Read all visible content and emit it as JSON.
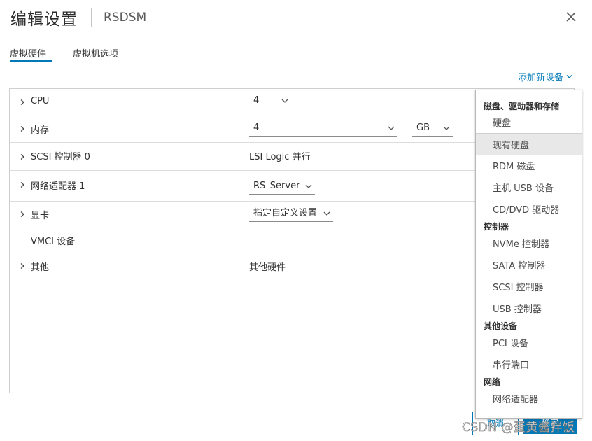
{
  "header": {
    "title": "编辑设置",
    "vm_name": "RSDSM"
  },
  "tabs": [
    {
      "label": "虚拟硬件",
      "active": true
    },
    {
      "label": "虚拟机选项",
      "active": false
    }
  ],
  "add_device_label": "添加新设备",
  "hardware": {
    "rows": [
      {
        "label": "CPU",
        "value": "4",
        "type": "select"
      },
      {
        "label": "内存",
        "value": "4",
        "unit": "GB",
        "type": "select"
      },
      {
        "label": "SCSI 控制器 0",
        "value": "LSI Logic 并行",
        "type": "text"
      },
      {
        "label": "网络适配器 1",
        "value": "RS_Server",
        "type": "select"
      },
      {
        "label": "显卡",
        "value": "指定自定义设置",
        "type": "select"
      },
      {
        "label": "VMCI 设备",
        "value": "",
        "type": "text"
      },
      {
        "label": "其他",
        "value": "其他硬件",
        "type": "text"
      }
    ]
  },
  "menu": {
    "groups": [
      {
        "header": "磁盘、驱动器和存储",
        "items": [
          "硬盘",
          "现有硬盘",
          "RDM 磁盘",
          "主机 USB 设备",
          "CD/DVD 驱动器"
        ]
      },
      {
        "header": "控制器",
        "items": [
          "NVMe 控制器",
          "SATA 控制器",
          "SCSI 控制器",
          "USB 控制器"
        ]
      },
      {
        "header": "其他设备",
        "items": [
          "PCI 设备",
          "串行端口"
        ]
      },
      {
        "header": "网络",
        "items": [
          "网络适配器"
        ]
      }
    ],
    "highlighted_item": "现有硬盘"
  },
  "footer": {
    "cancel_label": "取消",
    "ok_label": "确定"
  },
  "watermark": "CSDN @蛋黄酱拌饭",
  "colors": {
    "accent": "#0079b8",
    "text": "#313131",
    "border": "#cfcfcf"
  }
}
